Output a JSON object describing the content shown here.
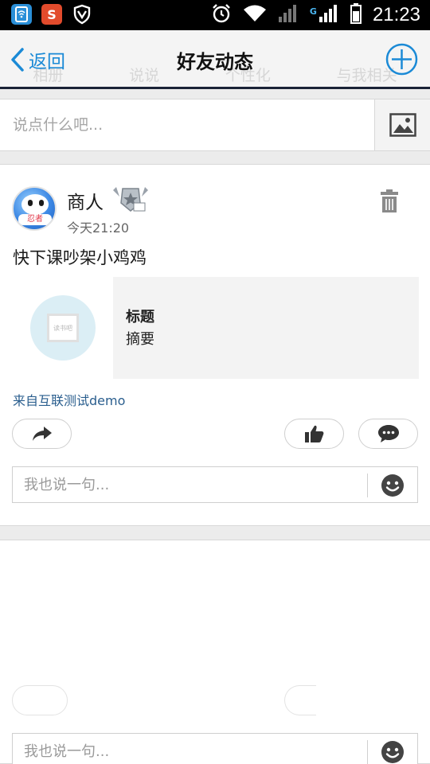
{
  "status_bar": {
    "time": "21:23",
    "network": "G",
    "app_icons": [
      "sim-manager-icon",
      "sogou-input-icon",
      "shield-icon"
    ],
    "system_icons": [
      "alarm-icon",
      "wifi-icon",
      "signal-icon",
      "battery-icon"
    ]
  },
  "header": {
    "back_label": "返回",
    "title": "好友动态",
    "background_tabs": [
      "相册",
      "说说",
      "个性化",
      "与我相关"
    ]
  },
  "compose": {
    "placeholder": "说点什么吧..."
  },
  "feed": [
    {
      "author": "商人",
      "time": "今天21:20",
      "avatar_tag": "忍者",
      "text": "快下课吵架小鸡鸡",
      "share": {
        "title": "标题",
        "summary": "摘要",
        "thumb_text": "读书吧"
      },
      "source": "来自互联测试demo",
      "reply_placeholder": "我也说一句..."
    },
    {
      "reply_placeholder": "我也说一句..."
    }
  ],
  "colors": {
    "accent": "#1b8ad6",
    "link": "#2a5e8e",
    "background": "#ececec"
  }
}
